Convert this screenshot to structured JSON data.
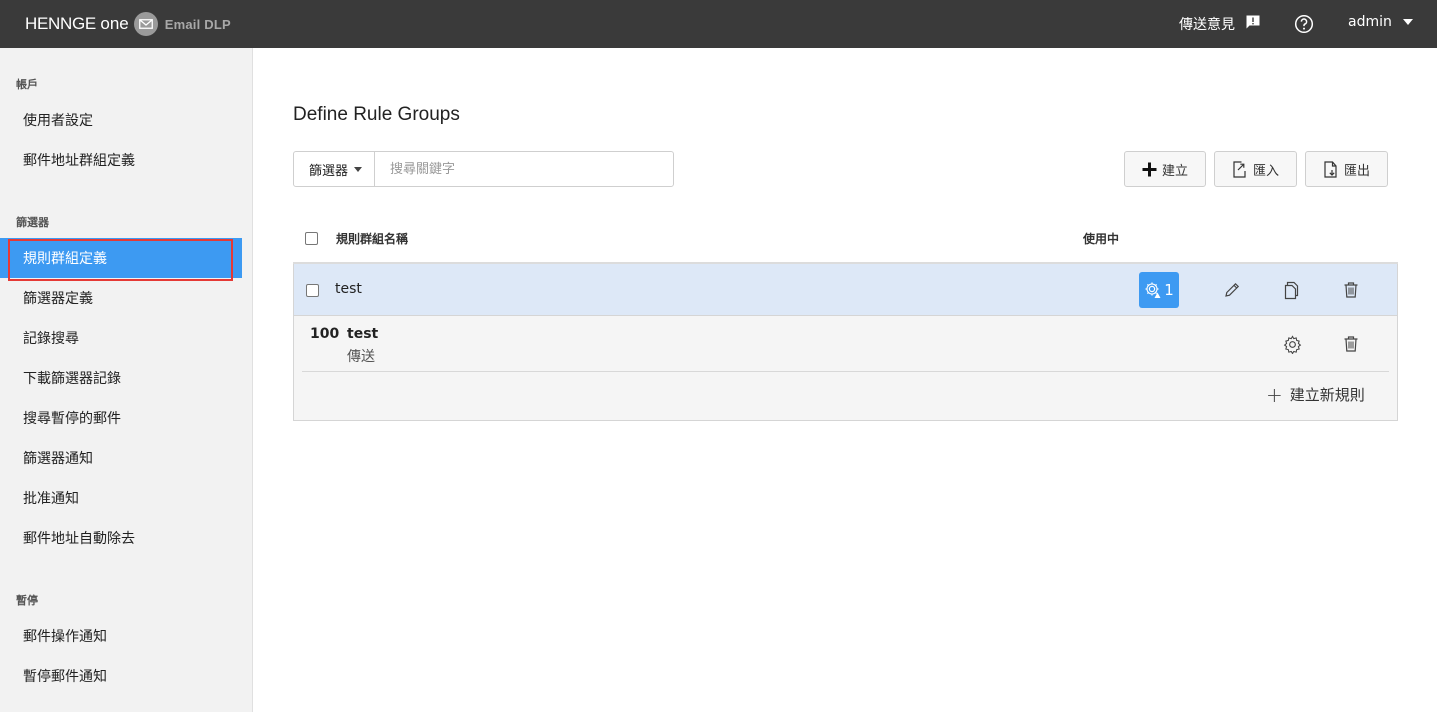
{
  "header": {
    "brand_main": "HENNGE",
    "brand_one": "one",
    "product": "Email DLP",
    "feedback_label": "傳送意見",
    "user": "admin"
  },
  "sidebar": {
    "sections": [
      {
        "title": "帳戶",
        "items": [
          "使用者設定",
          "郵件地址群組定義"
        ]
      },
      {
        "title": "篩選器",
        "items": [
          "規則群組定義",
          "篩選器定義",
          "記錄搜尋",
          "下載篩選器記錄",
          "搜尋暫停的郵件",
          "篩選器通知",
          "批准通知",
          "郵件地址自動除去"
        ]
      },
      {
        "title": "暫停",
        "items": [
          "郵件操作通知",
          "暫停郵件通知"
        ]
      }
    ],
    "active_item": "規則群組定義"
  },
  "main": {
    "title": "Define Rule Groups",
    "filter": {
      "select_label": "篩選器",
      "placeholder": "搜尋關鍵字"
    },
    "toolbar": {
      "create_label": "建立",
      "import_label": "匯入",
      "export_label": "匯出"
    },
    "table": {
      "col_name": "規則群組名稱",
      "col_active": "使用中",
      "groups": [
        {
          "name": "test",
          "active_count": "1",
          "rules": [
            {
              "priority": "100",
              "name": "test",
              "action": "傳送"
            }
          ],
          "add_rule_label": "建立新規則"
        }
      ]
    }
  },
  "colors": {
    "topbar": "#3a3a3a",
    "accent": "#3d9af2",
    "active_outline": "#e53935",
    "selected_row": "#dde8f7"
  }
}
